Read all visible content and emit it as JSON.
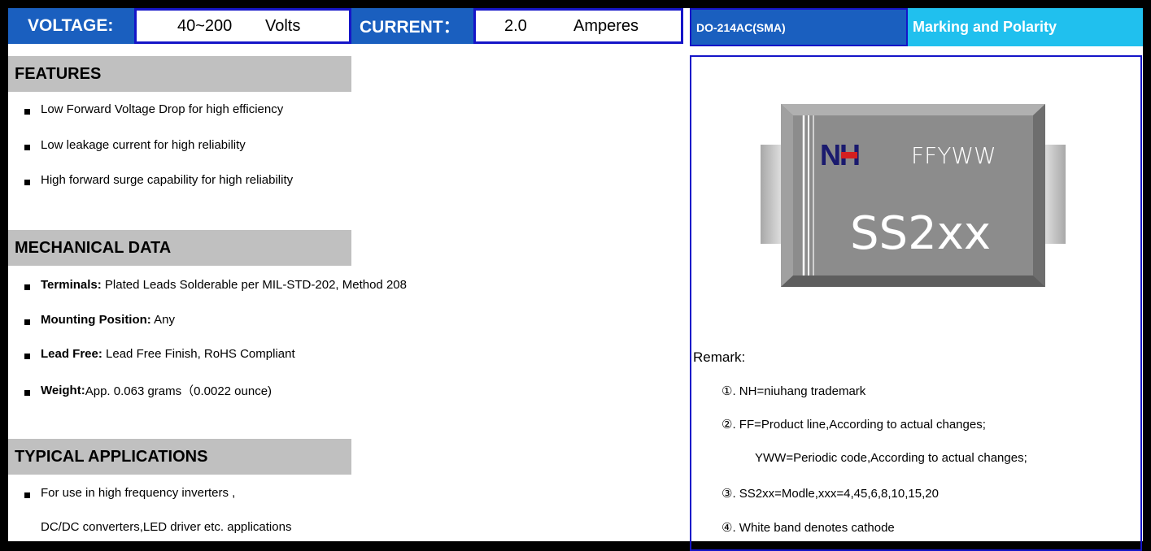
{
  "header": {
    "voltage_label": "VOLTAGE:",
    "voltage_value": "40~200",
    "voltage_unit": "Volts",
    "current_label": "CURRENT：",
    "current_value": "2.0",
    "current_unit": "Amperes",
    "package": "DO-214AC(SMA)",
    "marking_title": "Marking and Polarity"
  },
  "features": {
    "title": "FEATURES",
    "items": [
      "Low Forward Voltage Drop for high efficiency",
      "Low leakage current for high reliability",
      "High forward surge capability for high reliability"
    ]
  },
  "mechanical": {
    "title": "MECHANICAL DATA",
    "items": [
      {
        "label": "Terminals:",
        "text": " Plated Leads Solderable per MIL-STD-202, Method 208"
      },
      {
        "label": "Mounting Position:",
        "text": " Any"
      },
      {
        "label": "Lead Free:",
        "text": " Lead Free Finish, RoHS Compliant"
      },
      {
        "label": "Weight:",
        "text": "App. 0.063 grams（0.0022 ounce)"
      }
    ]
  },
  "applications": {
    "title": "TYPICAL APPLICATIONS",
    "line1": "For use in high frequency inverters ,",
    "line2": "DC/DC converters,LED driver etc. applications"
  },
  "package_drawing": {
    "logo": "NH",
    "code": "FFYWW",
    "model": "SS2xx",
    "logo_color": "#1a1a6e",
    "logo_accent": "#d42020"
  },
  "remark": {
    "title": "Remark:",
    "items": [
      "①. NH=niuhang trademark",
      "②. FF=Product line,According to actual changes;",
      "YWW=Periodic code,According to actual changes;",
      "③. SS2xx=Modle,xxx=4,45,6,8,10,15,20",
      "④. White band denotes cathode"
    ]
  }
}
